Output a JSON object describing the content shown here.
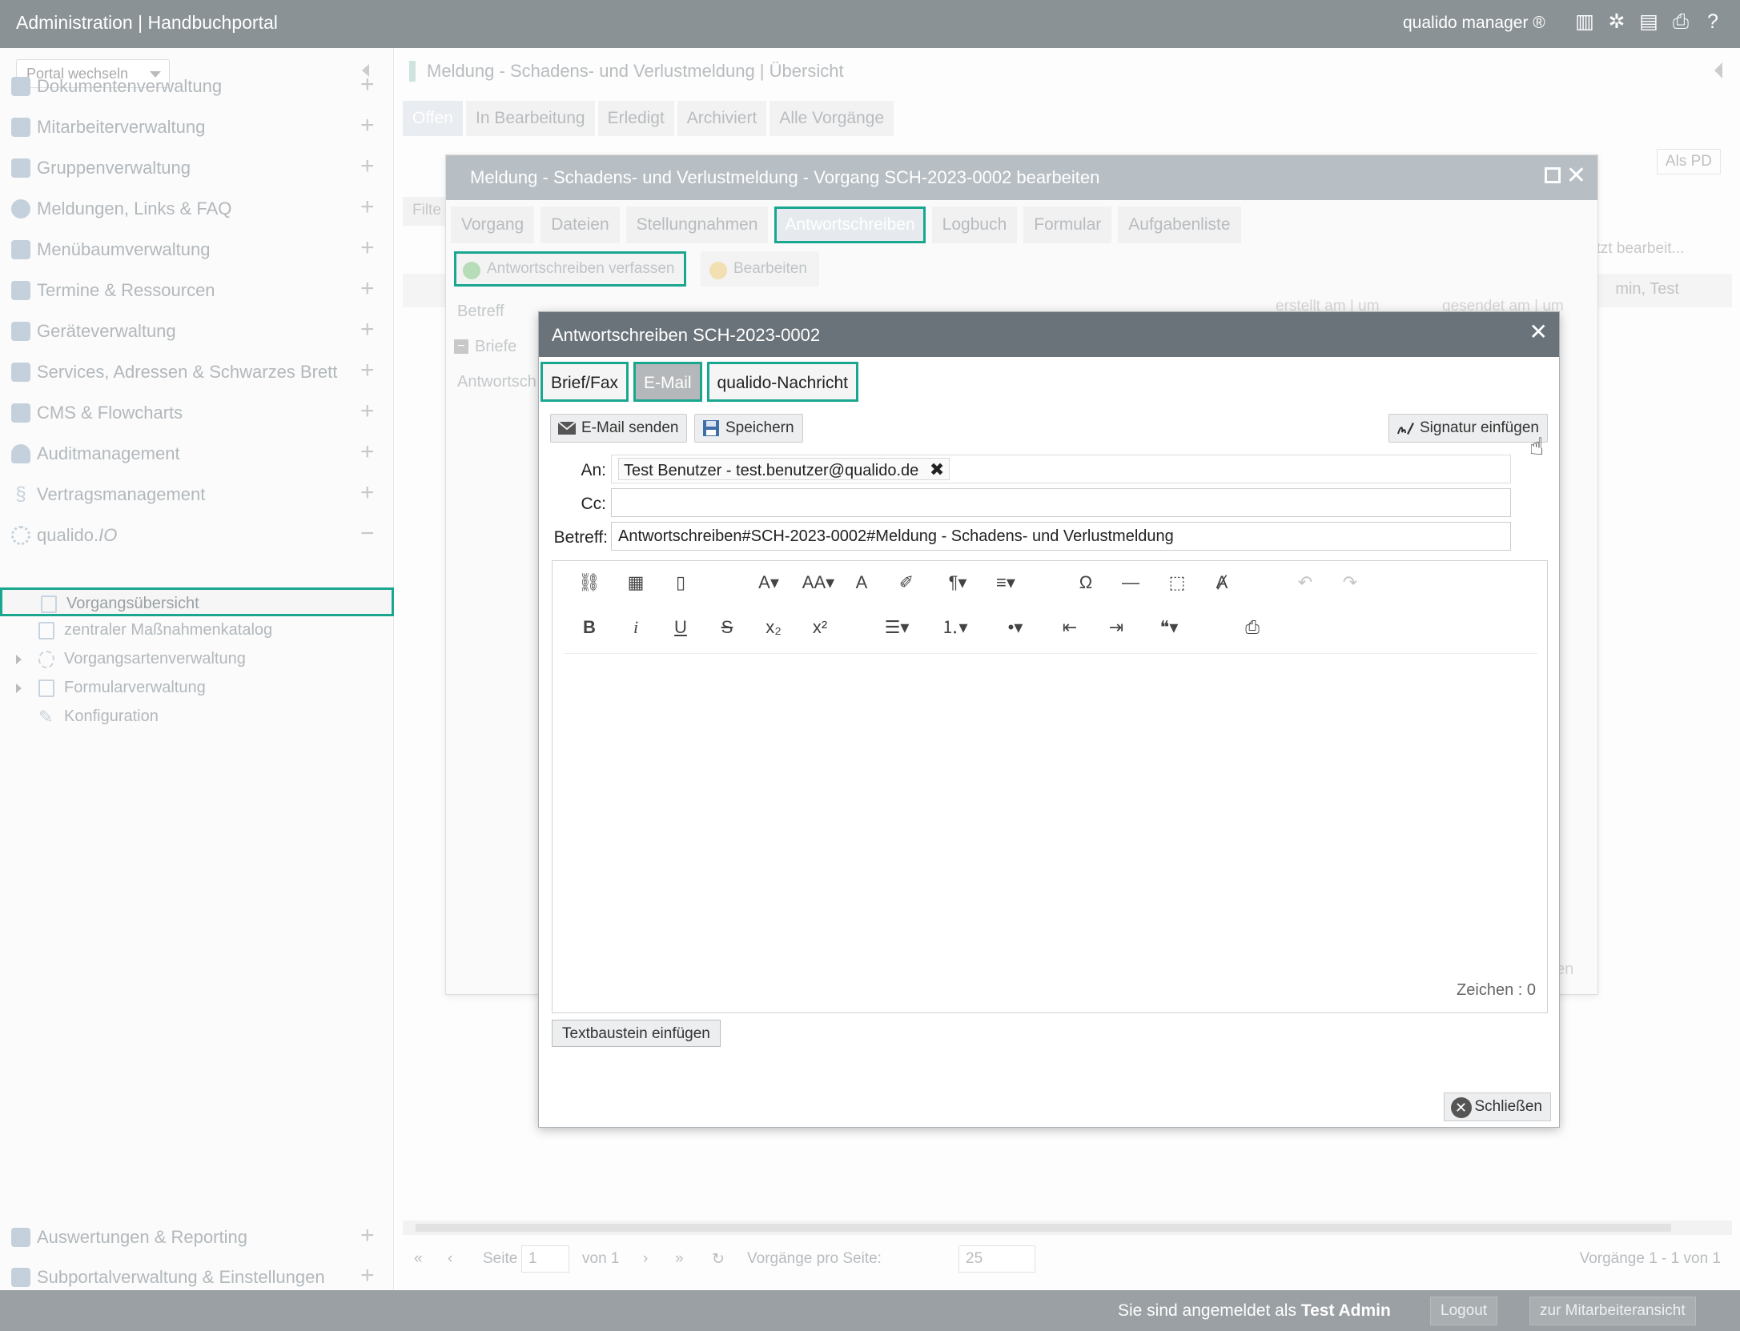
{
  "topbar": {
    "title": "Administration | Handbuchportal",
    "brand": "qualido manager ®",
    "icons": [
      "barcode-icon",
      "network-icon",
      "scanner-icon",
      "print-icon",
      "help-icon"
    ]
  },
  "sidebar": {
    "portal_select": "Portal wechseln",
    "items": [
      {
        "label": "Dokumentenverwaltung",
        "icon": "document-icon"
      },
      {
        "label": "Mitarbeiterverwaltung",
        "icon": "users-icon"
      },
      {
        "label": "Gruppenverwaltung",
        "icon": "group-icon"
      },
      {
        "label": "Meldungen, Links & FAQ",
        "icon": "chat-icon"
      },
      {
        "label": "Menübaumverwaltung",
        "icon": "list-icon"
      },
      {
        "label": "Termine & Ressourcen",
        "icon": "calendar-icon"
      },
      {
        "label": "Geräteverwaltung",
        "icon": "device-icon"
      },
      {
        "label": "Services, Adressen & Schwarzes Brett",
        "icon": "address-icon"
      },
      {
        "label": "CMS & Flowcharts",
        "icon": "cms-icon"
      },
      {
        "label": "Auditmanagement",
        "icon": "audit-icon"
      },
      {
        "label": "Vertragsmanagement",
        "icon": "paragraph-icon"
      }
    ],
    "qualido": {
      "prefix": "qualido.",
      "suffix": "IO"
    },
    "subitems": [
      {
        "label": "Vorgangsübersicht"
      },
      {
        "label": "zentraler Maßnahmenkatalog"
      },
      {
        "label": "Vorgangsartenverwaltung"
      },
      {
        "label": "Formularverwaltung"
      },
      {
        "label": "Konfiguration"
      }
    ],
    "bottom_items": [
      {
        "label": "Auswertungen & Reporting",
        "icon": "chart-icon"
      },
      {
        "label": "Subportalverwaltung & Einstellungen",
        "icon": "home-icon"
      }
    ]
  },
  "main": {
    "title": "Meldung - Schadens- und Verlustmeldung | Übersicht",
    "tabs": [
      "Offen",
      "In Bearbeitung",
      "Erledigt",
      "Archiviert",
      "Alle Vorgänge"
    ],
    "pdf_button": "Als PD",
    "filter_label": "Filte",
    "col_right": "etzt bearbeit...",
    "row_right": "min, Test",
    "pager": {
      "page_label": "Seite",
      "page_value": "1",
      "of_label": "von 1",
      "per_page_label": "Vorgänge pro Seite:",
      "per_page_value": "25",
      "range": "Vorgänge 1 - 1 von 1"
    }
  },
  "dialog1": {
    "title": "Meldung - Schadens- und Verlustmeldung - Vorgang SCH-2023-0002 bearbeiten",
    "tabs": [
      "Vorgang",
      "Dateien",
      "Stellungnahmen",
      "Antwortschreiben",
      "Logbuch",
      "Formular",
      "Aufgabenliste"
    ],
    "btn_compose": "Antwortschreiben verfassen",
    "btn_edit": "Bearbeiten",
    "betreff": "Betreff",
    "briefe": "Briefe",
    "antwortsch": "Antwortsch",
    "col_created": "erstellt am | um",
    "col_sent": "gesendet am | um",
    "bottom_btn": "en"
  },
  "dialog2": {
    "title": "Antwortschreiben SCH-2023-0002",
    "mode_tabs": [
      "Brief/Fax",
      "E-Mail",
      "qualido-Nachricht"
    ],
    "btn_send": "E-Mail senden",
    "btn_save": "Speichern",
    "btn_signature": "Signatur einfügen",
    "to_label": "An:",
    "to_chip": "Test Benutzer - test.benutzer@qualido.de",
    "cc_label": "Cc:",
    "cc_value": "",
    "subject_label": "Betreff:",
    "subject_value": "Antwortschreiben#SCH-2023-0002#Meldung - Schadens- und Verlustmeldung",
    "char_count": "Zeichen : 0",
    "btn_textblock": "Textbaustein einfügen",
    "btn_close": "Schließen"
  },
  "footer": {
    "login_prefix": "Sie sind angemeldet als",
    "login_user": "Test Admin",
    "logout": "Logout",
    "employee_view": "zur Mitarbeiteransicht"
  }
}
